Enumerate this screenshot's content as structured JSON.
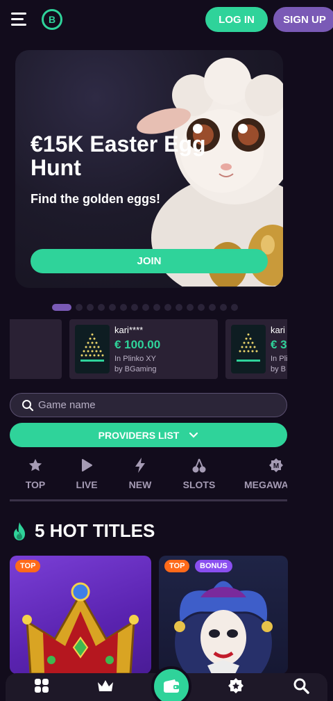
{
  "header": {
    "logo_letter": "B",
    "login_label": "LOG IN",
    "signup_label": "SIGN UP"
  },
  "hero": {
    "title": "€15K Easter Egg Hunt",
    "subtitle": "Find the golden eggs!",
    "cta_label": "JOIN",
    "slides_total": 16,
    "active_slide": 1
  },
  "winners": [
    {
      "user": "kari****",
      "amount": "€ 100.00",
      "game": "In Plinko XY",
      "provider": "by BGaming"
    },
    {
      "user": "kari",
      "amount": "€ 3",
      "game": "In Pli",
      "provider": "by B"
    }
  ],
  "search": {
    "placeholder": "Game name"
  },
  "providers": {
    "label": "PROVIDERS LIST"
  },
  "categories": [
    {
      "label": "TOP",
      "icon": "star-icon"
    },
    {
      "label": "LIVE",
      "icon": "play-icon"
    },
    {
      "label": "NEW",
      "icon": "lightning-icon"
    },
    {
      "label": "SLOTS",
      "icon": "cherry-icon"
    },
    {
      "label": "MEGAWA",
      "icon": "megaways-icon"
    }
  ],
  "section": {
    "title": "5 HOT TITLES"
  },
  "games": [
    {
      "tags": [
        "TOP"
      ]
    },
    {
      "tags": [
        "TOP",
        "BONUS"
      ]
    }
  ],
  "colors": {
    "background": "#120c1c",
    "accent_green": "#2fd39a",
    "accent_purple": "#7a5ab6",
    "tag_orange": "#ff6a1a",
    "tag_purple": "#8a4ff0"
  }
}
